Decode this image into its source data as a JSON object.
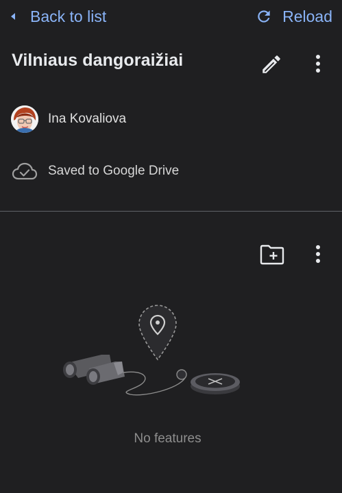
{
  "topbar": {
    "back_label": "Back to list",
    "back_icon": "chevron-left-icon",
    "reload_label": "Reload",
    "reload_icon": "refresh-icon"
  },
  "map": {
    "title": "Vilniaus dangoraižiai",
    "owner_name": "Ina Kovaliova",
    "save_status": "Saved to Google Drive"
  },
  "layers": {
    "empty_text": "No features"
  },
  "colors": {
    "background": "#1f1f21",
    "accent": "#8ab4f8",
    "text": "#e8eaed",
    "muted": "#8e8e8e",
    "divider": "#5f6368"
  }
}
